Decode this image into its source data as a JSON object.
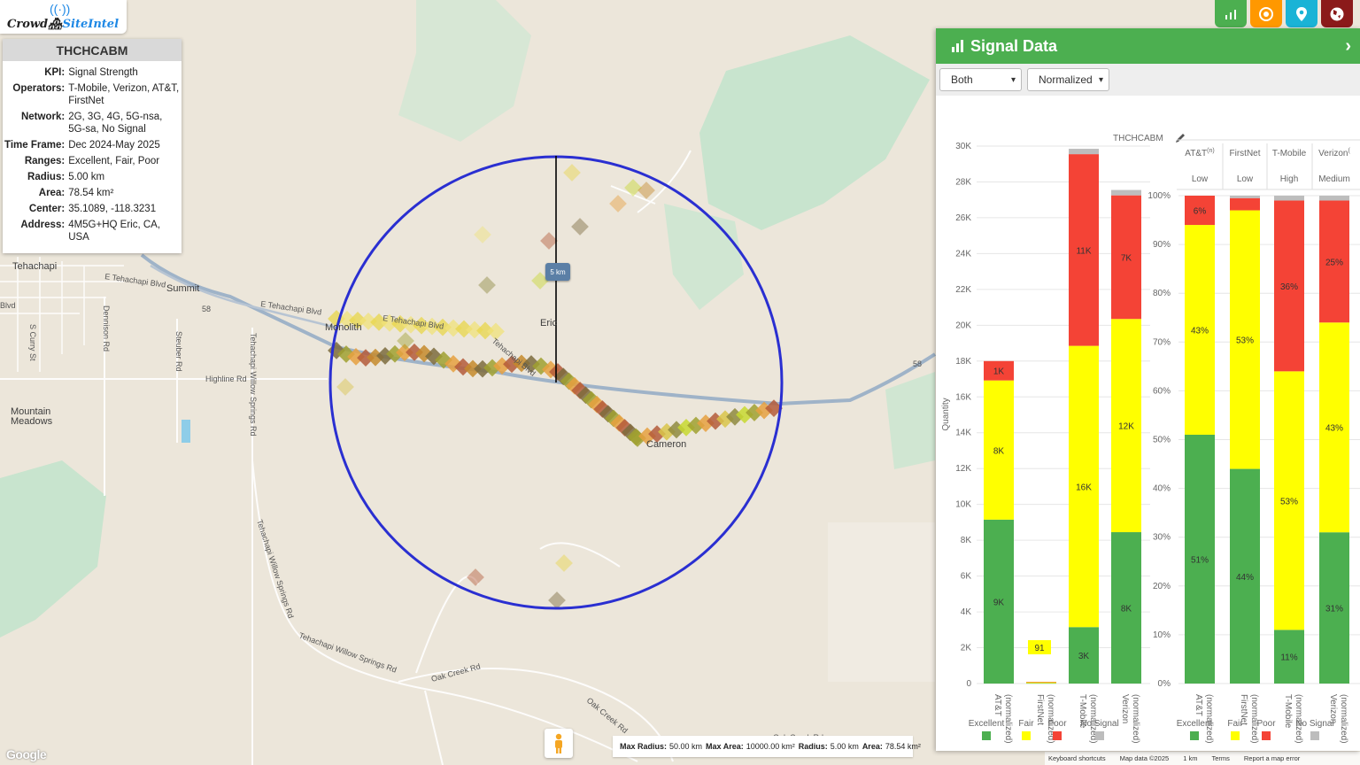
{
  "app": {
    "logo_text_1": "Crowd",
    "logo_text_2": "SiteIntel"
  },
  "info": {
    "title": "THCHCABM",
    "rows": [
      {
        "key": "KPI:",
        "value": "Signal Strength"
      },
      {
        "key": "Operators:",
        "value": "T-Mobile, Verizon, AT&T, FirstNet"
      },
      {
        "key": "Network:",
        "value": "2G, 3G, 4G, 5G-nsa, 5G-sa, No Signal"
      },
      {
        "key": "Time Frame:",
        "value": "Dec 2024-May 2025"
      },
      {
        "key": "Ranges:",
        "value": "Excellent, Fair, Poor"
      },
      {
        "key": "Radius:",
        "value": "5.00 km"
      },
      {
        "key": "Area:",
        "value": "78.54 km²"
      },
      {
        "key": "Center:",
        "value": "35.1089, -118.3231"
      },
      {
        "key": "Address:",
        "value": "4M5G+HQ Eric, CA, USA"
      }
    ]
  },
  "toolbar": {
    "buttons": [
      {
        "name": "chart-icon",
        "color": "#4caf50"
      },
      {
        "name": "target-icon",
        "color": "#ff9800"
      },
      {
        "name": "location-pin-icon",
        "color": "#1ab3d6"
      },
      {
        "name": "globe-icon",
        "color": "#8b1a1a"
      }
    ]
  },
  "map": {
    "scale_badge": "5 km",
    "places": [
      "Tehachapi",
      "Summit",
      "Monolith",
      "Eric",
      "Cameron",
      "Mountain",
      "Meadows"
    ],
    "roads": [
      "E Tehachapi Blvd",
      "E Tehachapi Blvd",
      "Highline Rd",
      "Tehachapi Willow Springs Rd",
      "Tehachapi Willow Springs Rd",
      "Tehachapi Willow Springs Rd",
      "Oak Creek Rd",
      "Oak Creek Rd",
      "Dennison Rd",
      "Steuber Rd",
      "S Curry St",
      "Blvd",
      "58",
      "58",
      "E Tehachapi Blvd",
      "Tehachapi Blvd",
      "Oak Creek Rd"
    ],
    "radius_bar": {
      "max_radius_label": "Max Radius:",
      "max_radius": "50.00 km",
      "max_area_label": "Max Area:",
      "max_area": "10000.00 km²",
      "radius_label": "Radius:",
      "radius": "5.00 km",
      "area_label": "Area:",
      "area": "78.54 km²"
    },
    "google": "Google",
    "attribution": [
      "Keyboard shortcuts",
      "Map data ©2025",
      "1 km",
      "Terms",
      "Report a map error"
    ]
  },
  "panel": {
    "title": "Signal Data",
    "select_operator": "Both",
    "select_mode": "Normalized",
    "chart_title": "THCHCABM",
    "quality_headers": [
      {
        "op": "AT&T",
        "sup": "(n)",
        "level": "Low",
        "color": "#e53935"
      },
      {
        "op": "FirstNet",
        "sup": "",
        "level": "Low",
        "color": "#e53935"
      },
      {
        "op": "T-Mobile",
        "sup": "",
        "level": "High",
        "color": "#43a047"
      },
      {
        "op": "Verizon",
        "sup": "(",
        "level": "Medium",
        "color": "#fb8c00"
      }
    ],
    "legend": [
      "Excellent",
      "Fair",
      "Poor",
      "No Signal"
    ],
    "y_axis_label": "Quantity"
  },
  "chart_data": [
    {
      "type": "bar",
      "stacked": true,
      "title": "THCHCABM",
      "ylabel": "Quantity",
      "ylim": [
        0,
        30000
      ],
      "yticks": [
        "0",
        "2K",
        "4K",
        "6K",
        "8K",
        "10K",
        "12K",
        "14K",
        "16K",
        "18K",
        "20K",
        "22K",
        "24K",
        "26K",
        "28K",
        "30K"
      ],
      "categories": [
        "AT&T (normalized)",
        "FirstNet (normalized)",
        "T-Mobile (normalized)",
        "Verizon (normalized)"
      ],
      "series": [
        {
          "name": "Excellent",
          "color": "#4caf50",
          "values": [
            9150,
            20,
            3150,
            8450
          ],
          "labels": [
            "9K",
            "",
            "3K",
            "8K"
          ]
        },
        {
          "name": "Fair",
          "color": "#ffff00",
          "values": [
            7770,
            61,
            15700,
            11900
          ],
          "labels": [
            "8K",
            "",
            "16K",
            "12K"
          ]
        },
        {
          "name": "Poor",
          "color": "#f44336",
          "values": [
            1080,
            10,
            10700,
            6900
          ],
          "labels": [
            "1K",
            "",
            "11K",
            "7K"
          ]
        },
        {
          "name": "No Signal",
          "color": "#bdbdbd",
          "values": [
            0,
            0,
            300,
            300
          ],
          "labels": [
            "",
            "",
            "",
            ""
          ]
        }
      ],
      "annotations": [
        {
          "category": "FirstNet (normalized)",
          "text": "91"
        }
      ]
    },
    {
      "type": "bar",
      "stacked": true,
      "normalized": true,
      "ylim": [
        0,
        100
      ],
      "yticks": [
        "0%",
        "10%",
        "20%",
        "30%",
        "40%",
        "50%",
        "60%",
        "70%",
        "80%",
        "90%",
        "100%"
      ],
      "categories": [
        "AT&T (normalized)",
        "FirstNet (normalized)",
        "T-Mobile (normalized)",
        "Verizon (normalized)"
      ],
      "series": [
        {
          "name": "Excellent",
          "color": "#4caf50",
          "values": [
            51,
            44,
            11,
            31
          ],
          "labels": [
            "51%",
            "44%",
            "11%",
            "31%"
          ]
        },
        {
          "name": "Fair",
          "color": "#ffff00",
          "values": [
            43,
            53,
            53,
            43
          ],
          "labels": [
            "43%",
            "53%",
            "53%",
            "43%"
          ]
        },
        {
          "name": "Poor",
          "color": "#f44336",
          "values": [
            6,
            2.5,
            35,
            25
          ],
          "labels": [
            "6%",
            "",
            "36%",
            "25%"
          ]
        },
        {
          "name": "No Signal",
          "color": "#bdbdbd",
          "values": [
            0,
            0.5,
            1,
            1
          ],
          "labels": [
            "",
            "",
            "",
            ""
          ]
        }
      ]
    }
  ]
}
